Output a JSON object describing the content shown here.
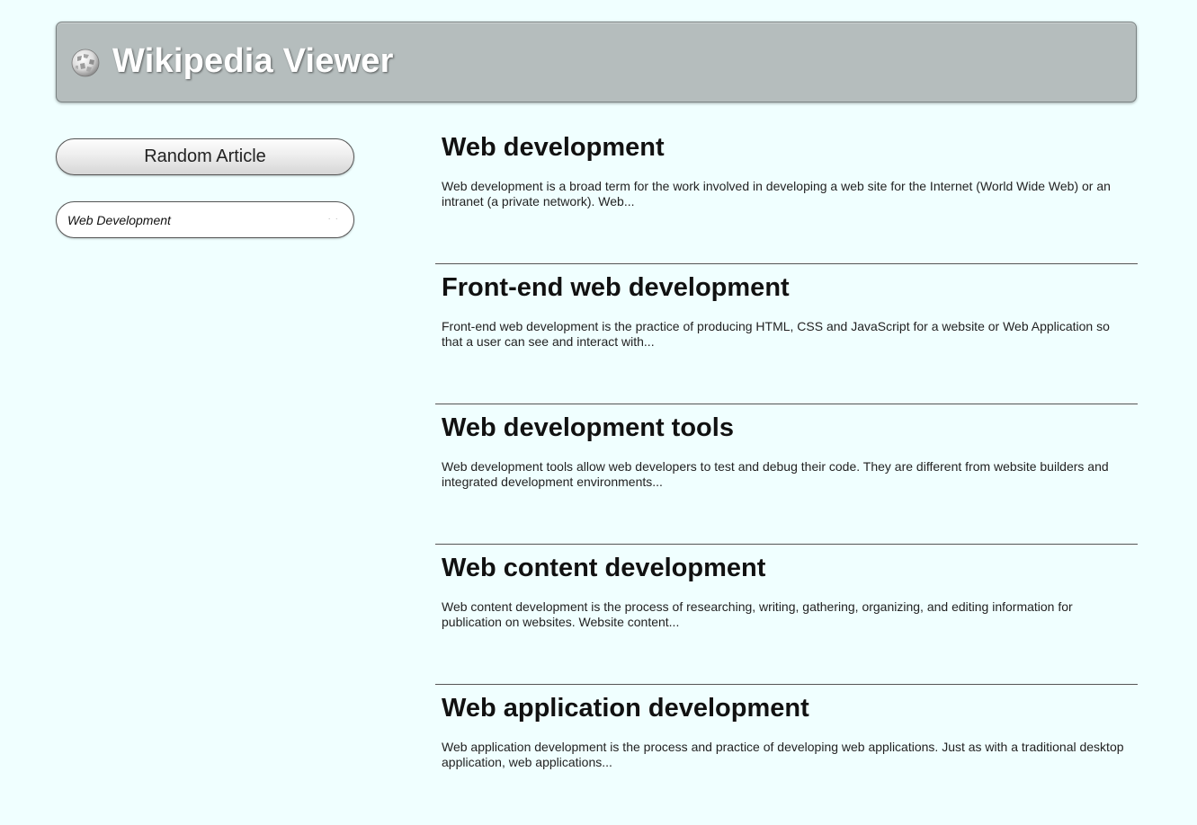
{
  "header": {
    "title": "Wikipedia Viewer",
    "logo_icon": "wikipedia-globe-icon",
    "background_color": "#b5bdbd"
  },
  "sidebar": {
    "random_button_label": "Random Article",
    "search": {
      "value": "Web Development"
    }
  },
  "results": [
    {
      "title": "Web development",
      "snippet": "Web development is a broad term for the work involved in developing a web site for the Internet (World Wide Web) or an intranet (a private network). Web..."
    },
    {
      "title": "Front-end web development",
      "snippet": "Front-end web development is the practice of producing HTML, CSS and JavaScript for a website or Web Application so that a user can see and interact with..."
    },
    {
      "title": "Web development tools",
      "snippet": "Web development tools allow web developers to test and debug their code. They are different from website builders and integrated development environments..."
    },
    {
      "title": "Web content development",
      "snippet": "Web content development is the process of researching, writing, gathering, organizing, and editing information for publication on websites. Website content..."
    },
    {
      "title": "Web application development",
      "snippet": "Web application development is the process and practice of developing web applications. Just as with a traditional desktop application, web applications..."
    }
  ],
  "colors": {
    "page_background": "#f0ffff",
    "divider": "#555555"
  }
}
